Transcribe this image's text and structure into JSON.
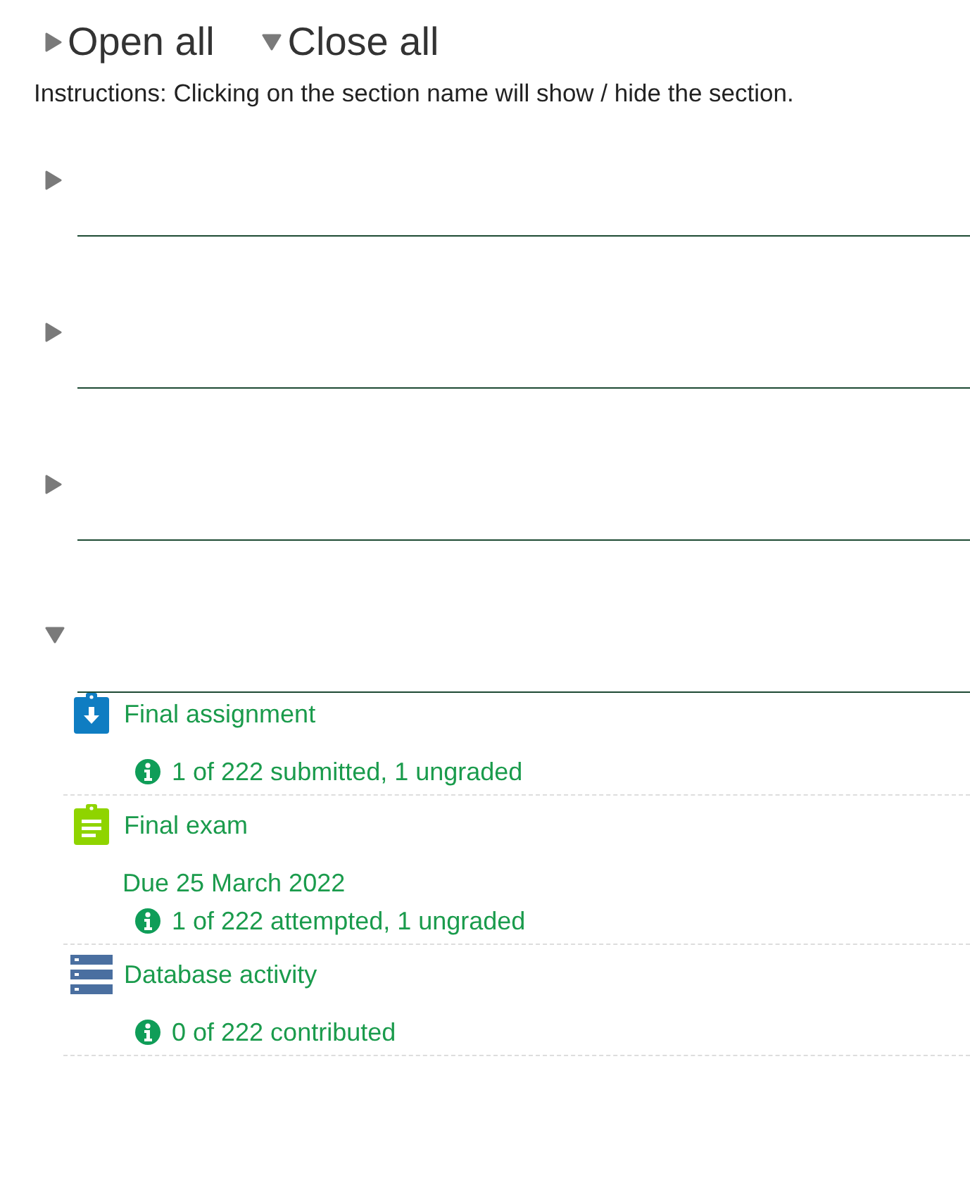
{
  "controls": [
    {
      "label": "Open all",
      "kind": "open"
    },
    {
      "label": "Close all",
      "kind": "close"
    }
  ],
  "instructions": "Instructions: Clicking on the section name will show / hide the section.",
  "sections": [
    {
      "expanded": false
    },
    {
      "expanded": false
    },
    {
      "expanded": false
    },
    {
      "expanded": true,
      "activities": [
        {
          "kind": "assignment",
          "name": "Final assignment",
          "info": "1 of 222 submitted, 1 ungraded"
        },
        {
          "kind": "quiz",
          "name": "Final exam",
          "due": "Due 25 March 2022",
          "info": "1 of 222 attempted, 1 ungraded"
        },
        {
          "kind": "database",
          "name": "Database activity",
          "info": "0 of 222 contributed"
        }
      ]
    }
  ]
}
